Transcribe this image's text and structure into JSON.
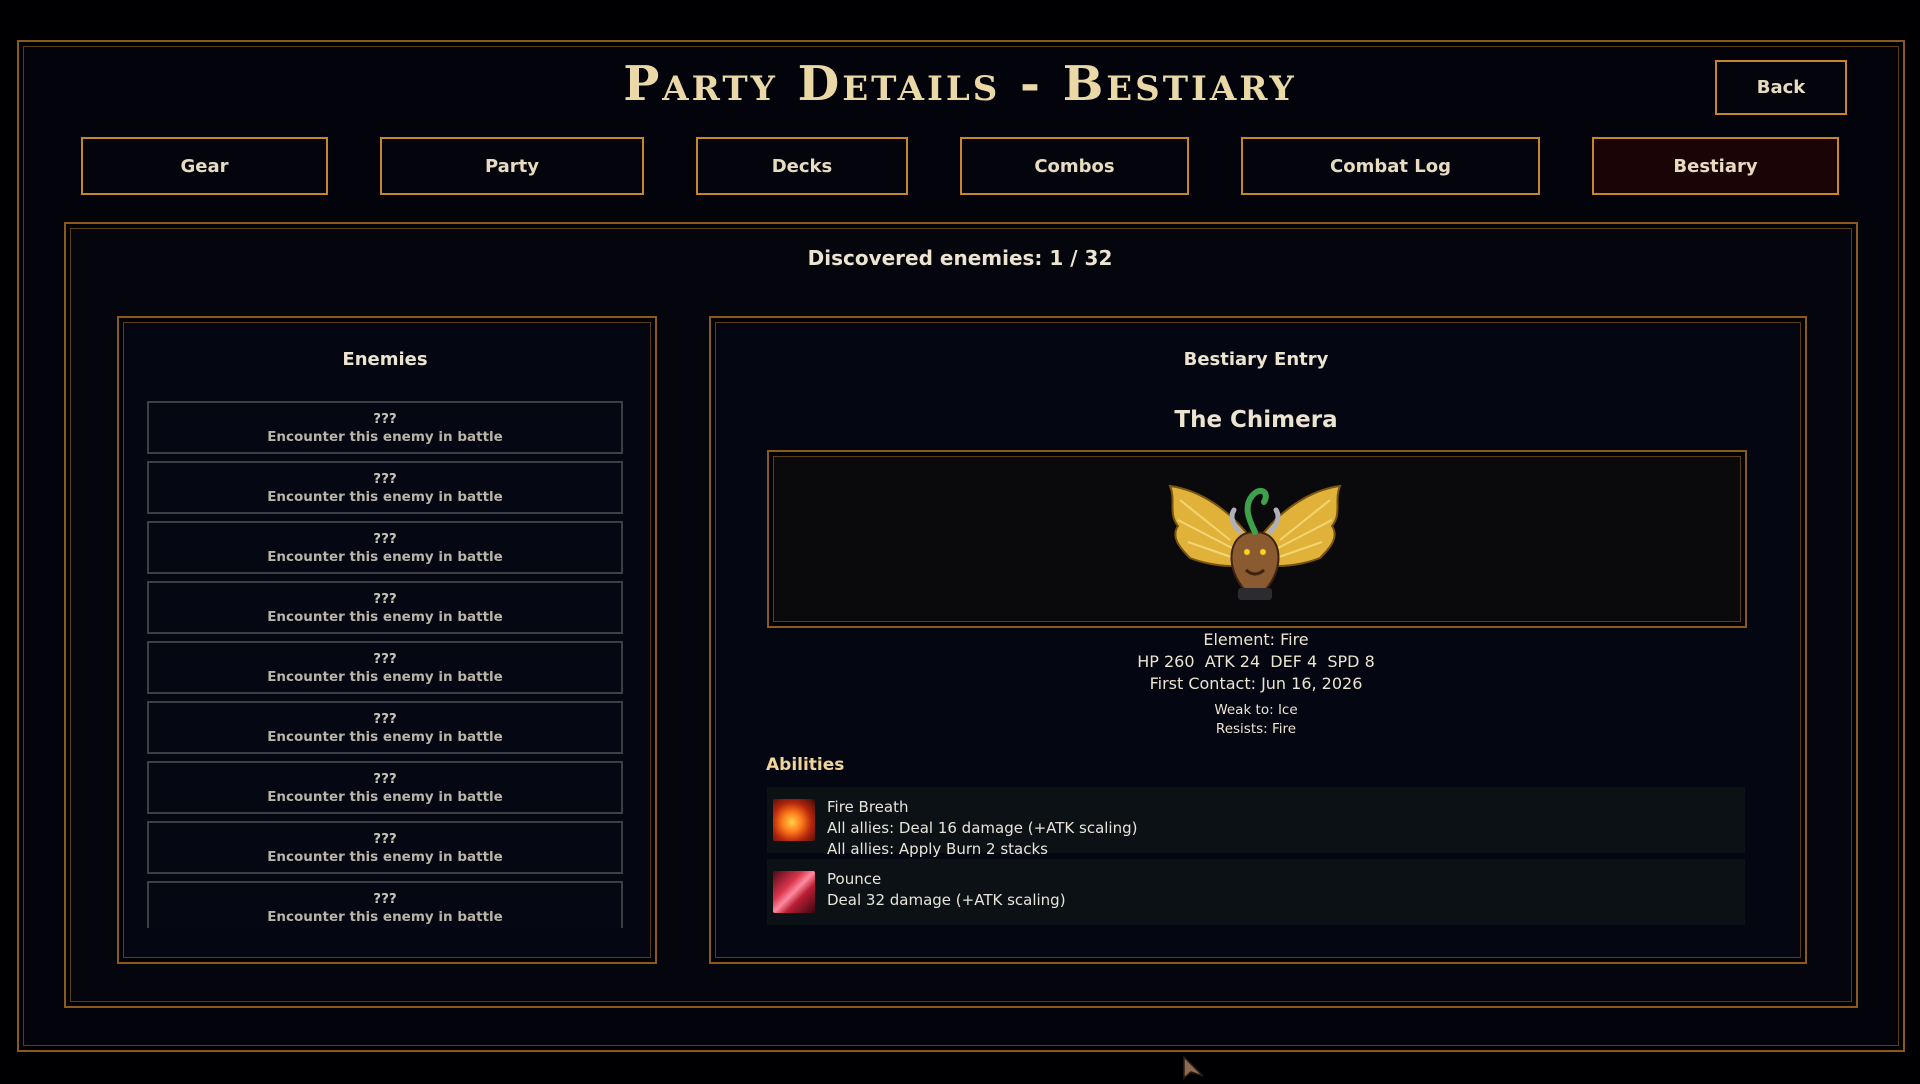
{
  "header": {
    "title": "Party Details - Bestiary",
    "back_label": "Back"
  },
  "tabs": [
    {
      "label": "Gear"
    },
    {
      "label": "Party"
    },
    {
      "label": "Decks"
    },
    {
      "label": "Combos"
    },
    {
      "label": "Combat Log"
    },
    {
      "label": "Bestiary",
      "active": true
    }
  ],
  "discovered": "Discovered enemies: 1 / 32",
  "enemies_panel": {
    "title": "Enemies",
    "items": [
      {
        "name": "???",
        "hint": "Encounter this enemy in battle"
      },
      {
        "name": "???",
        "hint": "Encounter this enemy in battle"
      },
      {
        "name": "???",
        "hint": "Encounter this enemy in battle"
      },
      {
        "name": "???",
        "hint": "Encounter this enemy in battle"
      },
      {
        "name": "???",
        "hint": "Encounter this enemy in battle"
      },
      {
        "name": "???",
        "hint": "Encounter this enemy in battle"
      },
      {
        "name": "???",
        "hint": "Encounter this enemy in battle"
      },
      {
        "name": "???",
        "hint": "Encounter this enemy in battle"
      },
      {
        "name": "???",
        "hint": "Encounter this enemy in battle"
      }
    ]
  },
  "entry": {
    "title": "Bestiary Entry",
    "name": "The Chimera",
    "element": "Element: Fire",
    "stats": "HP 260  ATK 24  DEF 4  SPD 8",
    "first_contact": "First Contact: Jun 16, 2026",
    "weak": "Weak to: Ice",
    "resists": "Resists: Fire",
    "abilities_label": "Abilities",
    "abilities": [
      {
        "icon": "fire-breath-icon",
        "name": "Fire Breath",
        "lines": [
          "All allies: Deal 16 damage (+ATK scaling)",
          "All allies: Apply Burn 2 stacks"
        ]
      },
      {
        "icon": "pounce-claw-icon",
        "name": "Pounce",
        "lines": [
          "Deal 32 damage (+ATK scaling)"
        ]
      }
    ]
  },
  "colors": {
    "border": "#c8862a",
    "frame": "#8a5a1c",
    "title": "#ead9a6",
    "active_tab": "#1a0406"
  }
}
